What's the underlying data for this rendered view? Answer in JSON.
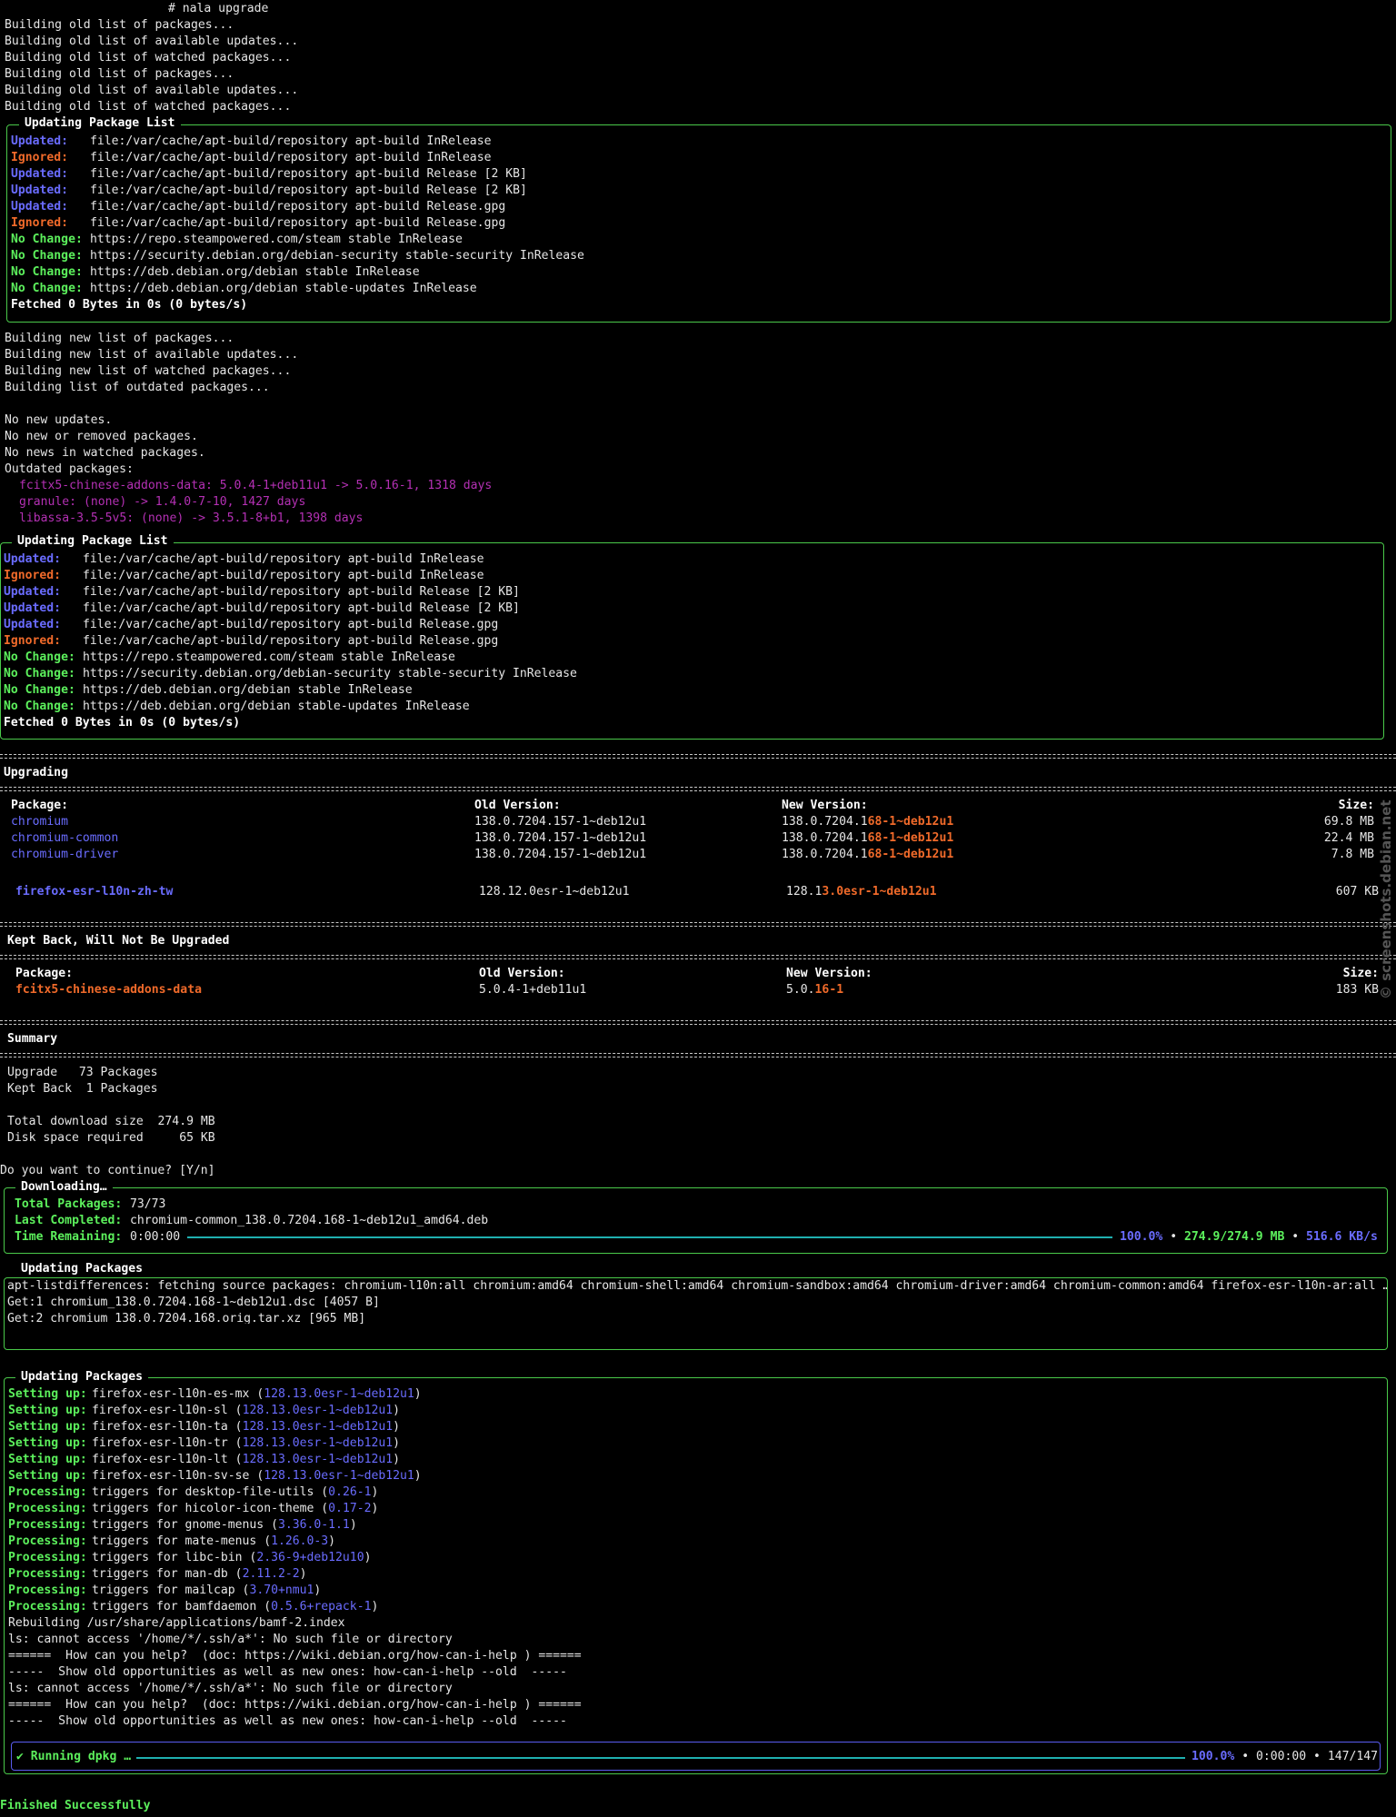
{
  "prompt": "# nala upgrade",
  "pre_lines": [
    "Building old list of packages...",
    "Building old list of available updates...",
    "Building old list of watched packages...",
    "Building old list of packages...",
    "Building old list of available updates...",
    "Building old list of watched packages..."
  ],
  "update_box_title": "Updating Package List",
  "update_rows": [
    {
      "status": "Updated:",
      "kind": "updated",
      "text": "file:/var/cache/apt-build/repository apt-build InRelease"
    },
    {
      "status": "Ignored:",
      "kind": "ignored",
      "text": "file:/var/cache/apt-build/repository apt-build InRelease"
    },
    {
      "status": "Updated:",
      "kind": "updated",
      "text": "file:/var/cache/apt-build/repository apt-build Release [2 KB]"
    },
    {
      "status": "Updated:",
      "kind": "updated",
      "text": "file:/var/cache/apt-build/repository apt-build Release [2 KB]"
    },
    {
      "status": "Updated:",
      "kind": "updated",
      "text": "file:/var/cache/apt-build/repository apt-build Release.gpg"
    },
    {
      "status": "Ignored:",
      "kind": "ignored",
      "text": "file:/var/cache/apt-build/repository apt-build Release.gpg"
    },
    {
      "status": "No Change:",
      "kind": "nochange",
      "text": "https://repo.steampowered.com/steam stable InRelease"
    },
    {
      "status": "No Change:",
      "kind": "nochange",
      "text": "https://security.debian.org/debian-security stable-security InRelease"
    },
    {
      "status": "No Change:",
      "kind": "nochange",
      "text": "https://deb.debian.org/debian stable InRelease"
    },
    {
      "status": "No Change:",
      "kind": "nochange",
      "text": "https://deb.debian.org/debian stable-updates InRelease"
    }
  ],
  "fetched": "Fetched 0 Bytes in 0s (0 bytes/s)",
  "new_lines": [
    "Building new list of packages...",
    "Building new list of available updates...",
    "Building new list of watched packages...",
    "Building list of outdated packages..."
  ],
  "status_lines": [
    "No new updates.",
    "No new or removed packages.",
    "No news in watched packages.",
    "Outdated packages:"
  ],
  "outdated": [
    "fcitx5-chinese-addons-data: 5.0.4-1+deb11u1 -> 5.0.16-1, 1318 days",
    "granule: (none) -> 1.4.0-7-10, 1427 days",
    "libassa-3.5-5v5: (none) -> 3.5.1-8+b1, 1398 days"
  ],
  "upgrading": {
    "title": "Upgrading",
    "headers": {
      "package": "Package:",
      "old": "Old Version:",
      "new": "New Version:",
      "size": "Size:"
    },
    "rows": [
      {
        "package": "chromium",
        "old": "138.0.7204.157-1~deb12u1",
        "new_common": "138.0.7204.1",
        "new_diff": "68-1~deb12u1",
        "size": "69.8 MB"
      },
      {
        "package": "chromium-common",
        "old": "138.0.7204.157-1~deb12u1",
        "new_common": "138.0.7204.1",
        "new_diff": "68-1~deb12u1",
        "size": "22.4 MB"
      },
      {
        "package": "chromium-driver",
        "old": "138.0.7204.157-1~deb12u1",
        "new_common": "138.0.7204.1",
        "new_diff": "68-1~deb12u1",
        "size": "7.8 MB"
      }
    ],
    "last_row": {
      "package": "firefox-esr-l10n-zh-tw",
      "old": "128.12.0esr-1~deb12u1",
      "new_common": "128.1",
      "new_diff": "3.0esr-1~deb12u1",
      "size": "607 KB"
    }
  },
  "kept_back": {
    "title": "Kept Back, Will Not Be Upgraded",
    "row": {
      "package": "fcitx5-chinese-addons-data",
      "old": "5.0.4-1+deb11u1",
      "new_common": "5.0.",
      "new_diff": "16-1",
      "size": "183 KB"
    }
  },
  "summary": {
    "title": "Summary",
    "upgrade": "Upgrade   73 Packages",
    "kept": "Kept Back  1 Packages",
    "download": "Total download size  274.9 MB",
    "disk": "Disk space required     65 KB"
  },
  "prompt_continue": "Do you want to continue? [Y/n]",
  "downloading": {
    "title": "Downloading…",
    "total_label": "Total Packages:",
    "total_value": "73/73",
    "last_label": "Last Completed:",
    "last_value": "chromium-common_138.0.7204.168-1~deb12u1_amd64.deb",
    "remaining_label": "Time Remaining:",
    "remaining_value": "0:00:00",
    "percent": "100.0%",
    "bytes": "274.9/274.9 MB",
    "speed": "516.6 KB/s",
    "progress": 1.0
  },
  "updating_packages_1": {
    "title": "Updating Packages",
    "lines": [
      "apt-listdifferences: fetching source packages: chromium-l10n:all chromium:amd64 chromium-shell:amd64 chromium-sandbox:amd64 chromium-driver:amd64 chromium-common:amd64 firefox-esr-l10n-ar:all …",
      "Get:1 chromium_138.0.7204.168-1~deb12u1.dsc [4057 B]",
      "Get:2 chromium_138.0.7204.168.orig.tar.xz [965 MB]"
    ]
  },
  "updating_packages_2": {
    "title": "Updating Packages",
    "setting_up": [
      {
        "label": "Setting up:",
        "pkg": "firefox-esr-l10n-es-mx",
        "ver": "128.13.0esr-1~deb12u1"
      },
      {
        "label": "Setting up:",
        "pkg": "firefox-esr-l10n-sl",
        "ver": "128.13.0esr-1~deb12u1"
      },
      {
        "label": "Setting up:",
        "pkg": "firefox-esr-l10n-ta",
        "ver": "128.13.0esr-1~deb12u1"
      },
      {
        "label": "Setting up:",
        "pkg": "firefox-esr-l10n-tr",
        "ver": "128.13.0esr-1~deb12u1"
      },
      {
        "label": "Setting up:",
        "pkg": "firefox-esr-l10n-lt",
        "ver": "128.13.0esr-1~deb12u1"
      },
      {
        "label": "Setting up:",
        "pkg": "firefox-esr-l10n-sv-se",
        "ver": "128.13.0esr-1~deb12u1"
      }
    ],
    "processing": [
      {
        "label": "Processing:",
        "pkg": "triggers for desktop-file-utils",
        "ver": "0.26-1"
      },
      {
        "label": "Processing:",
        "pkg": "triggers for hicolor-icon-theme",
        "ver": "0.17-2"
      },
      {
        "label": "Processing:",
        "pkg": "triggers for gnome-menus",
        "ver": "3.36.0-1.1"
      },
      {
        "label": "Processing:",
        "pkg": "triggers for mate-menus",
        "ver": "1.26.0-3"
      },
      {
        "label": "Processing:",
        "pkg": "triggers for libc-bin",
        "ver": "2.36-9+deb12u10"
      },
      {
        "label": "Processing:",
        "pkg": "triggers for man-db",
        "ver": "2.11.2-2"
      },
      {
        "label": "Processing:",
        "pkg": "triggers for mailcap",
        "ver": "3.70+nmu1"
      },
      {
        "label": "Processing:",
        "pkg": "triggers for bamfdaemon",
        "ver": "0.5.6+repack-1"
      }
    ],
    "tail_lines": [
      "Rebuilding /usr/share/applications/bamf-2.index",
      "ls: cannot access '/home/*/.ssh/a*': No such file or directory",
      "======  How can you help?  (doc: https://wiki.debian.org/how-can-i-help ) ======",
      "-----  Show old opportunities as well as new ones: how-can-i-help --old  -----",
      "ls: cannot access '/home/*/.ssh/a*': No such file or directory",
      "======  How can you help?  (doc: https://wiki.debian.org/how-can-i-help ) ======",
      "-----  Show old opportunities as well as new ones: how-can-i-help --old  -----"
    ]
  },
  "dpkg": {
    "label": "✔ Running dpkg …",
    "percent": "100.0%",
    "elapsed": "0:00:00",
    "count": "147/147",
    "progress": 1.0
  },
  "finished": "Finished Successfully",
  "watermark": "© screenshots.debian.net",
  "colors": {
    "green": "#5cf05c",
    "blue": "#6a6cff",
    "orange": "#f06a2a",
    "magenta": "#b430b4",
    "border_green": "#4ac94a",
    "border_blue": "#5a5cf0",
    "bar": "#1fb0b0"
  }
}
